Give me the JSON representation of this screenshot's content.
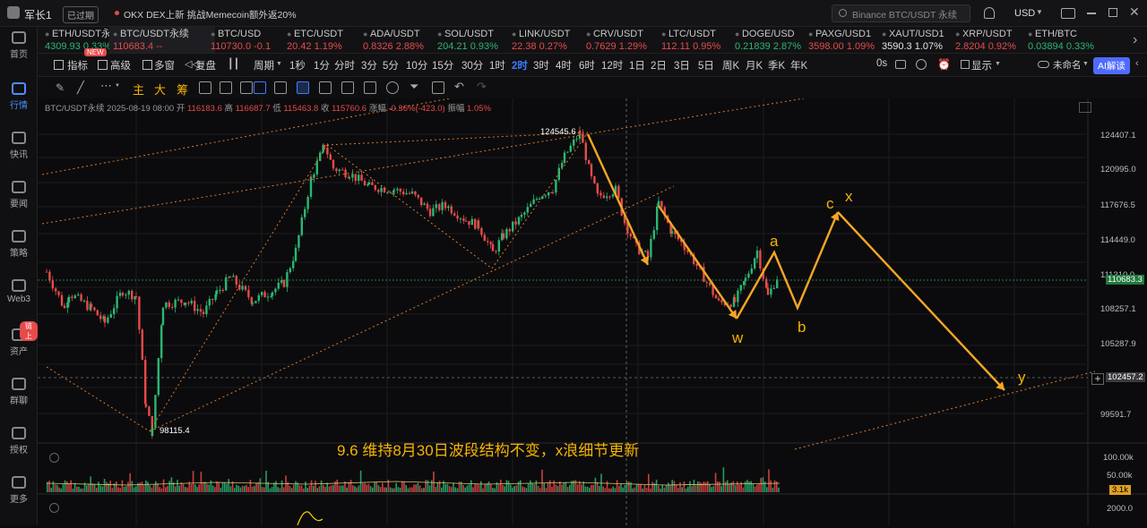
{
  "titlebar": {
    "app_title": "军长1",
    "status": "已过期",
    "news": "OKX DEX上新 挑战Memecoin额外返20%",
    "search_placeholder": "Binance BTC/USDT 永续",
    "currency": "USD"
  },
  "sidebar": [
    {
      "label": "首页",
      "icon": "home-icon"
    },
    {
      "label": "行情",
      "icon": "chart-icon"
    },
    {
      "label": "快讯",
      "icon": "news-icon"
    },
    {
      "label": "要闻",
      "icon": "article-icon"
    },
    {
      "label": "策略",
      "icon": "strategy-icon"
    },
    {
      "label": "Web3",
      "icon": "web3-icon"
    },
    {
      "label": "资产",
      "icon": "wallet-icon",
      "badge": "链上"
    },
    {
      "label": "群聊",
      "icon": "chat-icon"
    },
    {
      "label": "授权",
      "icon": "key-icon"
    },
    {
      "label": "更多",
      "icon": "more-icon"
    }
  ],
  "tickers": [
    {
      "name": "ETH/USDT永",
      "price": "4309.93",
      "change": "0.33%",
      "dir": "up"
    },
    {
      "name": "BTC/USDT永续",
      "price": "110683.4",
      "change": "--",
      "dir": "dn"
    },
    {
      "name": "BTC/USD",
      "price": "110730.0",
      "change": "-0.1",
      "dir": "dn"
    },
    {
      "name": "ETC/USDT",
      "price": "20.42",
      "change": "1.19%",
      "dir": "dn"
    },
    {
      "name": "ADA/USDT",
      "price": "0.8326",
      "change": "2.88%",
      "dir": "dn"
    },
    {
      "name": "SOL/USDT",
      "price": "204.21",
      "change": "0.93%",
      "dir": "up"
    },
    {
      "name": "LINK/USDT",
      "price": "22.38",
      "change": "0.27%",
      "dir": "dn"
    },
    {
      "name": "CRV/USDT",
      "price": "0.7629",
      "change": "1.29%",
      "dir": "dn"
    },
    {
      "name": "LTC/USDT",
      "price": "112.11",
      "change": "0.95%",
      "dir": "dn"
    },
    {
      "name": "DOGE/USD",
      "price": "0.21839",
      "change": "2.87%",
      "dir": "up"
    },
    {
      "name": "PAXG/USD1",
      "price": "3598.00",
      "change": "1.09%",
      "dir": "dn"
    },
    {
      "name": "XAUT/USD1",
      "price": "3590.3",
      "change": "1.07%",
      "dir": "wh"
    },
    {
      "name": "XRP/USDT",
      "price": "2.8204",
      "change": "0.92%",
      "dir": "dn"
    },
    {
      "name": "ETH/BTC",
      "price": "0.03894",
      "change": "0.33%",
      "dir": "up"
    }
  ],
  "toolbar": {
    "indicator": "指标",
    "advanced": "高级",
    "new_badge": "NEW",
    "multi_window": "多窗",
    "replay": "复盘",
    "period": "周期",
    "timeframes": [
      "1秒",
      "1分",
      "分时",
      "3分",
      "5分",
      "10分",
      "15分",
      "30分",
      "1时",
      "2时",
      "3时",
      "4时",
      "6时",
      "12时",
      "1日",
      "2日",
      "3日",
      "5日",
      "周K",
      "月K",
      "季K",
      "年K"
    ],
    "selected_timeframe": "2时",
    "countdown": "0s",
    "display": "显示",
    "unnamed": "未命名",
    "ai_button": "AI解读"
  },
  "drawing_tools": [
    "主",
    "大",
    "筹"
  ],
  "ohlc": {
    "symbol": "BTC/USDT永续",
    "datetime": "2025-08-19 08:00",
    "open_label": "开",
    "open": "116183.6",
    "high_label": "高",
    "high": "116687.7",
    "low_label": "低",
    "low": "115463.8",
    "close_label": "收",
    "close": "115760.6",
    "change_label": "涨幅",
    "change": "-0.36%(-423.0)",
    "amp_label": "振幅",
    "amp": "1.05%"
  },
  "price_axis": [
    "124407.1",
    "120995.0",
    "117676.5",
    "114449.0",
    "111310.0",
    "108257.1",
    "105287.9",
    "99591.7"
  ],
  "current_price": "110683.3",
  "crosshair_price": "102457.2",
  "volume_axis": [
    "100.00k",
    "50.00k",
    "3.1k"
  ],
  "indicator_axis": [
    "2000.0"
  ],
  "annotations": {
    "high": "124545.6",
    "low": "98115.4",
    "note": "9.6  维持8月30日波段结构不变，x浪细节更新",
    "waves": [
      "w",
      "a",
      "b",
      "c",
      "x",
      "y"
    ]
  },
  "colors": {
    "up": "#2bb673",
    "down": "#e84a4a",
    "accent": "#f5b400",
    "selected": "#3d7bff"
  }
}
